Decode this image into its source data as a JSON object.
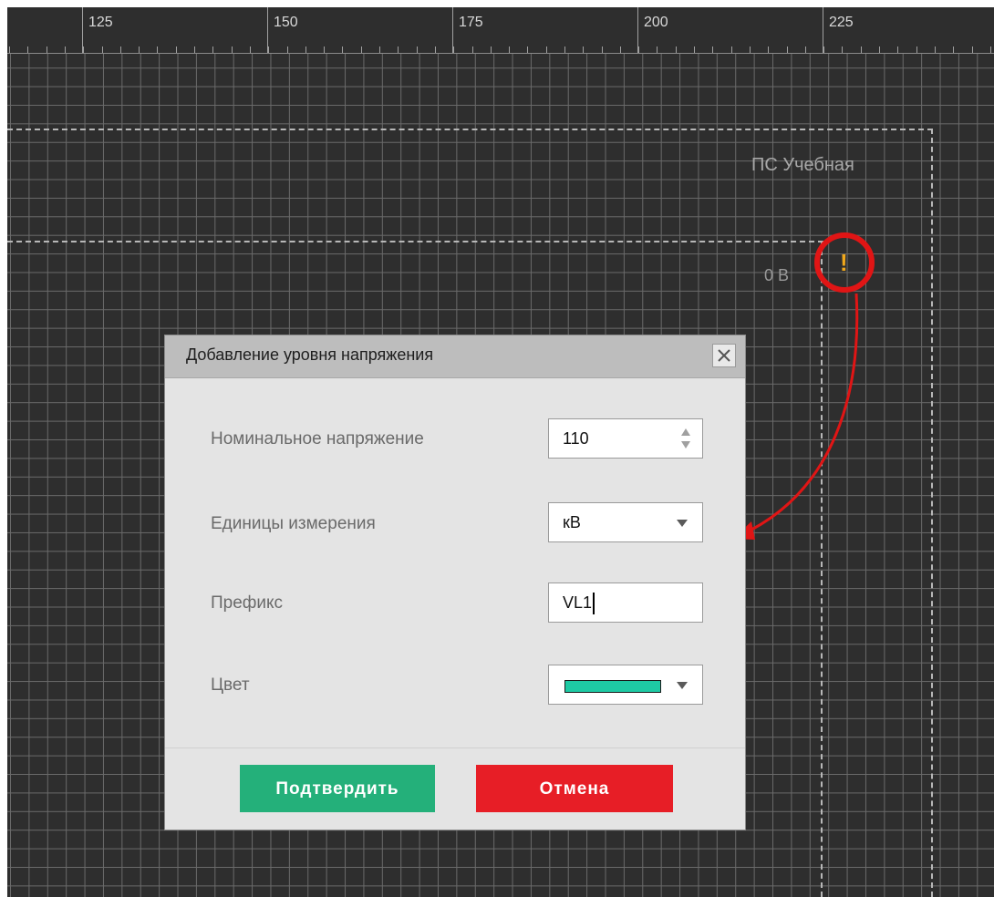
{
  "ruler": {
    "labels": [
      "125",
      "150",
      "175",
      "200",
      "225"
    ]
  },
  "canvas": {
    "substation_label": "ПС Учебная",
    "voltage_level_label": "0 В",
    "warning_mark": "!"
  },
  "colors": {
    "canvas_background": "#2e2e2e",
    "annotation_red": "#e01515",
    "warning_orange": "#f0a81c",
    "confirm_green": "#24b07a",
    "cancel_red": "#e71e26",
    "selected_color": "#1ecaa4"
  },
  "dialog": {
    "title": "Добавление уровня напряжения",
    "close_icon": "close-icon",
    "fields": {
      "nominal_voltage": {
        "label": "Номинальное напряжение",
        "value": "110"
      },
      "units": {
        "label": "Единицы измерения",
        "value": "кВ"
      },
      "prefix": {
        "label": "Префикс",
        "value": "VL1"
      },
      "color": {
        "label": "Цвет",
        "value": "#1ecaa4"
      }
    },
    "confirm_label": "Подтвердить",
    "cancel_label": "Отмена"
  }
}
